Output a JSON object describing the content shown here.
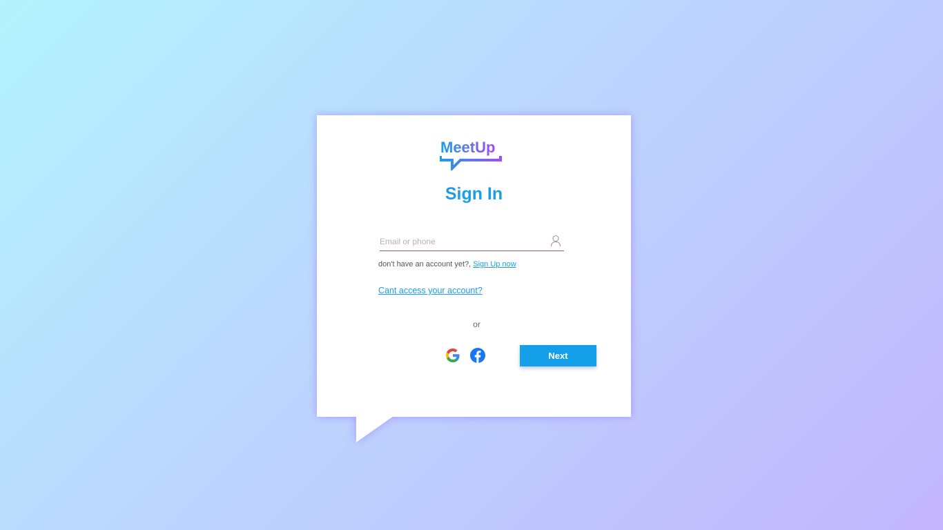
{
  "brand": {
    "logo_text": "MeetUp",
    "gradient_start": "#1a9fe6",
    "gradient_end": "#a24df2"
  },
  "signin": {
    "title": "Sign In",
    "title_color": "#1a9fe6",
    "email_placeholder": "Email or phone",
    "email_value": "",
    "email_icon": "user-icon",
    "no_account_text": "don't have an account yet?, ",
    "signup_link": "Sign Up now",
    "access_link": "Cant access your account?",
    "or_text": "or",
    "social_icons": [
      "google-icon",
      "facebook-icon"
    ],
    "next_label": "Next",
    "accent_color": "#14a0e8",
    "underline_color": "#7a4df0"
  }
}
